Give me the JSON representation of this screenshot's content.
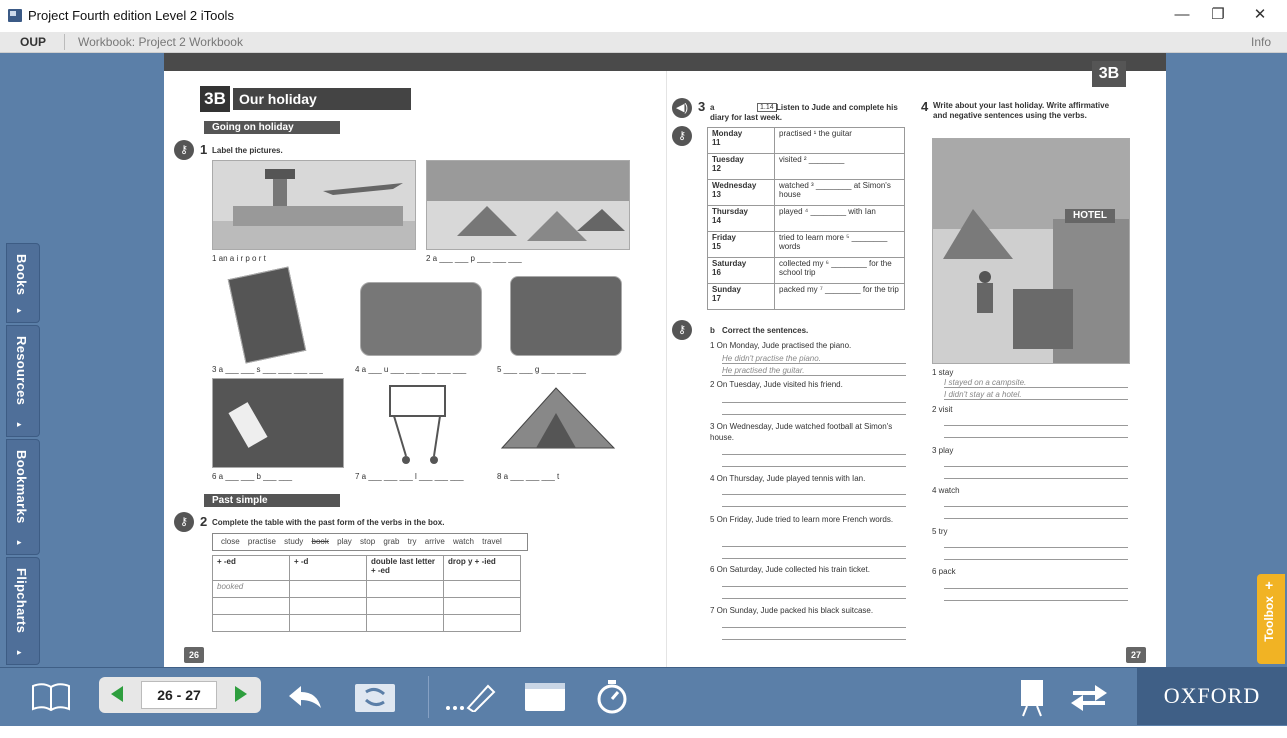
{
  "window": {
    "title": "Project Fourth edition Level 2 iTools",
    "minimize": "—",
    "restore": "❐",
    "close": "✕"
  },
  "menubar": {
    "brand": "OUP",
    "workbook": "Workbook: Project 2 Workbook",
    "info": "Info"
  },
  "side_tabs": [
    {
      "label": "Books"
    },
    {
      "label": "Resources"
    },
    {
      "label": "Bookmarks"
    },
    {
      "label": "Flipcharts"
    }
  ],
  "toolbox": {
    "label": "Toolbox"
  },
  "toolbar": {
    "page_range": "26 - 27",
    "publisher": "OXFORD"
  },
  "left_page": {
    "unit": "3B",
    "title": "Our holiday",
    "section1": "Going on holiday",
    "ex1": {
      "num": "1",
      "instruction": "Label the pictures."
    },
    "labels": [
      "1 an a i r p o r t",
      "2 a ___ ___ p ___ ___ ___",
      "3 a ___ ___ s ___ ___ ___ ___",
      "4 a ___ u ___ ___ ___ ___ ___",
      "5 ___ ___ g ___ ___ ___",
      "6 a ___ ___ b ___ ___",
      "7 a ___ ___ ___ l ___ ___ ___",
      "8 a ___ ___ ___ t"
    ],
    "section2": "Past simple",
    "ex2": {
      "num": "2",
      "instruction": "Complete the table with the past form of the verbs in the box."
    },
    "verbs": [
      "close",
      "practise",
      "study",
      "book",
      "play",
      "stop",
      "grab",
      "try",
      "arrive",
      "watch",
      "travel"
    ],
    "table_headers": [
      "+ -ed",
      "+ -d",
      "double last letter + -ed",
      "drop y + -ied"
    ],
    "table_example": "booked",
    "page_number": "26"
  },
  "right_page": {
    "unit": "3B",
    "ex3": {
      "num": "3",
      "part": "a",
      "track": "1.14",
      "instruction": "Listen to Jude and complete his diary for last week."
    },
    "diary": [
      {
        "day": "Monday",
        "date": "11",
        "entry": "practised ¹ the guitar"
      },
      {
        "day": "Tuesday",
        "date": "12",
        "entry": "visited ² ________"
      },
      {
        "day": "Wednesday",
        "date": "13",
        "entry": "watched ³ ________ at Simon's house"
      },
      {
        "day": "Thursday",
        "date": "14",
        "entry": "played ⁴ ________ with Ian"
      },
      {
        "day": "Friday",
        "date": "15",
        "entry": "tried to learn more ⁵ ________ words"
      },
      {
        "day": "Saturday",
        "date": "16",
        "entry": "collected my ⁶ ________ for the school trip"
      },
      {
        "day": "Sunday",
        "date": "17",
        "entry": "packed my ⁷ ________ for the trip"
      }
    ],
    "ex3b": {
      "part": "b",
      "instruction": "Correct the sentences."
    },
    "sentences": [
      "1  On Monday, Jude practised the piano.",
      "2  On Tuesday, Jude visited his friend.",
      "3  On Wednesday, Jude watched football at Simon's house.",
      "4  On Thursday, Jude played tennis with Ian.",
      "5  On Friday, Jude tried to learn more French words.",
      "6  On Saturday, Jude collected his train ticket.",
      "7  On Sunday, Jude packed his black suitcase."
    ],
    "answers1": [
      "He didn't practise the piano.",
      "He practised the guitar."
    ],
    "ex4": {
      "num": "4",
      "instruction": "Write about your last holiday. Write affirmative and negative sentences using the verbs."
    },
    "hotel_sign": "HOTEL",
    "prompts": [
      "1  stay",
      "2  visit",
      "3  play",
      "4  watch",
      "5  try",
      "6  pack"
    ],
    "answers_stay": [
      "I stayed on a campsite.",
      "I didn't stay at a hotel."
    ],
    "page_number": "27"
  },
  "colors": {
    "workspace": "#5b7fa8",
    "toolbox": "#f1b324",
    "oxford_bg": "#3f5f86",
    "pager_arrow": "#2e9e3e"
  }
}
